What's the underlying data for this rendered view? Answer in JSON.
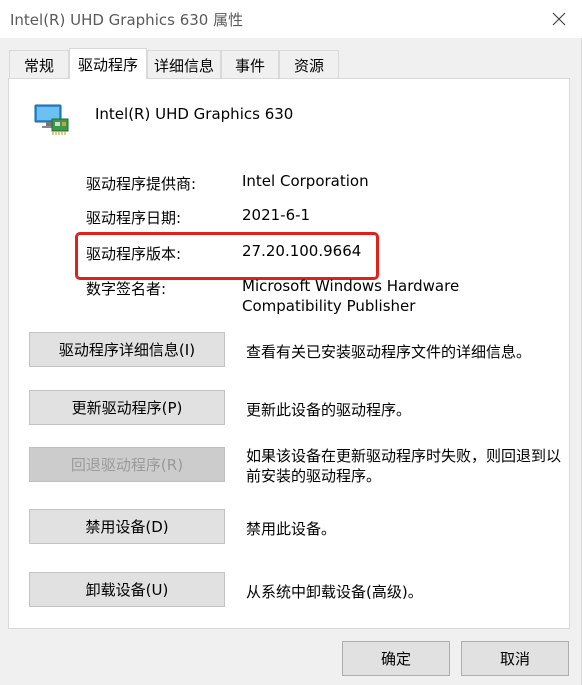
{
  "window": {
    "title": "Intel(R) UHD Graphics 630 属性",
    "close_icon": "close-icon"
  },
  "tabs": [
    {
      "label": "常规",
      "active": false
    },
    {
      "label": "驱动程序",
      "active": true
    },
    {
      "label": "详细信息",
      "active": false
    },
    {
      "label": "事件",
      "active": false
    },
    {
      "label": "资源",
      "active": false
    }
  ],
  "device": {
    "icon": "display-adapter-icon",
    "name": "Intel(R) UHD Graphics 630"
  },
  "info": {
    "provider_label": "驱动程序提供商:",
    "provider_value": "Intel Corporation",
    "date_label": "驱动程序日期:",
    "date_value": "2021-6-1",
    "version_label": "驱动程序版本:",
    "version_value": "27.20.100.9664",
    "signer_label": "数字签名者:",
    "signer_value": "Microsoft Windows Hardware Compatibility Publisher"
  },
  "highlight_color": "#e0201b",
  "actions": [
    {
      "button": "驱动程序详细信息(I)",
      "desc": "查看有关已安装驱动程序文件的详细信息。",
      "enabled": true
    },
    {
      "button": "更新驱动程序(P)",
      "desc": "更新此设备的驱动程序。",
      "enabled": true
    },
    {
      "button": "回退驱动程序(R)",
      "desc": "如果该设备在更新驱动程序时失败，则回退到以前安装的驱动程序。",
      "enabled": false
    },
    {
      "button": "禁用设备(D)",
      "desc": "禁用此设备。",
      "enabled": true
    },
    {
      "button": "卸载设备(U)",
      "desc": "从系统中卸载设备(高级)。",
      "enabled": true
    }
  ],
  "footer": {
    "ok_label": "确定",
    "cancel_label": "取消"
  }
}
